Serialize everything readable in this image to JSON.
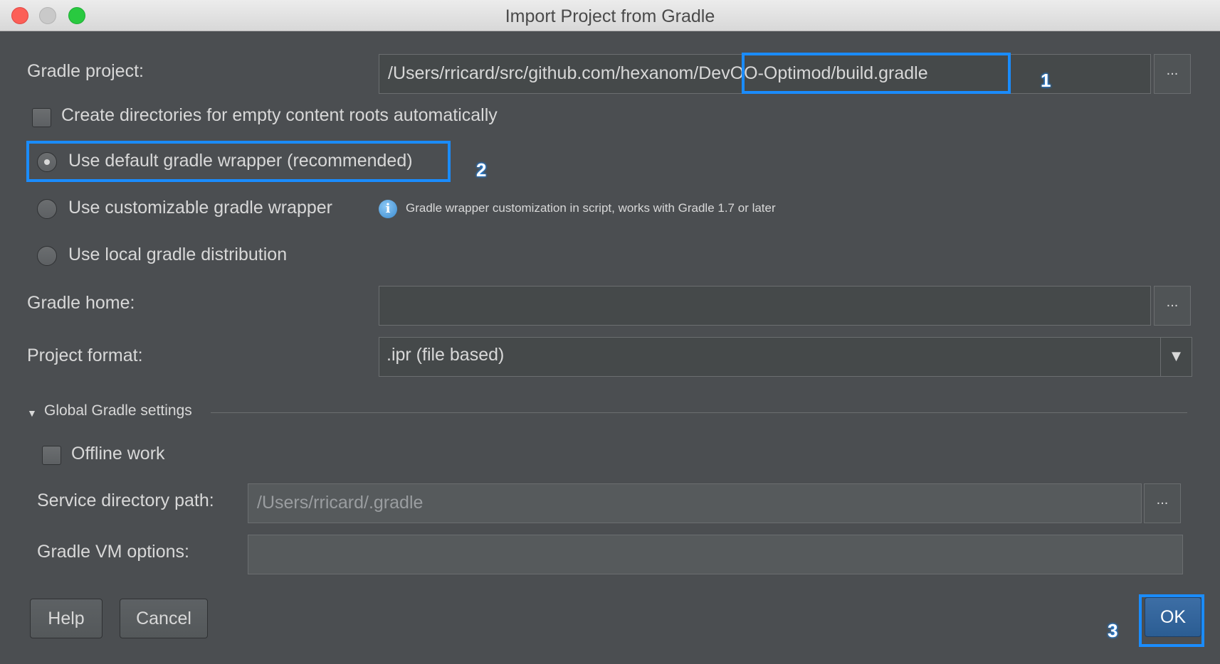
{
  "window": {
    "title": "Import Project from Gradle"
  },
  "gradle_project": {
    "label": "Gradle project:",
    "value": "/Users/rricard/src/github.com/hexanom/DevOO-Optimod/build.gradle",
    "browse": "..."
  },
  "create_dirs": {
    "label": "Create directories for empty content roots automatically",
    "checked": false
  },
  "wrapper_options": {
    "default_label": "Use default gradle wrapper (recommended)",
    "custom_label": "Use customizable gradle wrapper",
    "local_label": "Use local gradle distribution",
    "selected": "default",
    "info_icon": "i",
    "info_text": "Gradle wrapper customization in script, works with Gradle 1.7 or later"
  },
  "gradle_home": {
    "label": "Gradle home:",
    "value": "",
    "browse": "..."
  },
  "project_format": {
    "label": "Project format:",
    "selected": ".ipr (file based)",
    "arrow": "▼"
  },
  "global_settings": {
    "label": "Global Gradle settings",
    "triangle": "▼",
    "offline_label": "Offline work",
    "offline_checked": false,
    "service_dir_label": "Service directory path:",
    "service_dir_value": "/Users/rricard/.gradle",
    "service_dir_browse": "...",
    "vm_options_label": "Gradle VM options:",
    "vm_options_value": ""
  },
  "buttons": {
    "help": "Help",
    "cancel": "Cancel",
    "ok": "OK"
  },
  "annotations": {
    "n1": "1",
    "n2": "2",
    "n3": "3",
    "color": "#1a8cff"
  }
}
